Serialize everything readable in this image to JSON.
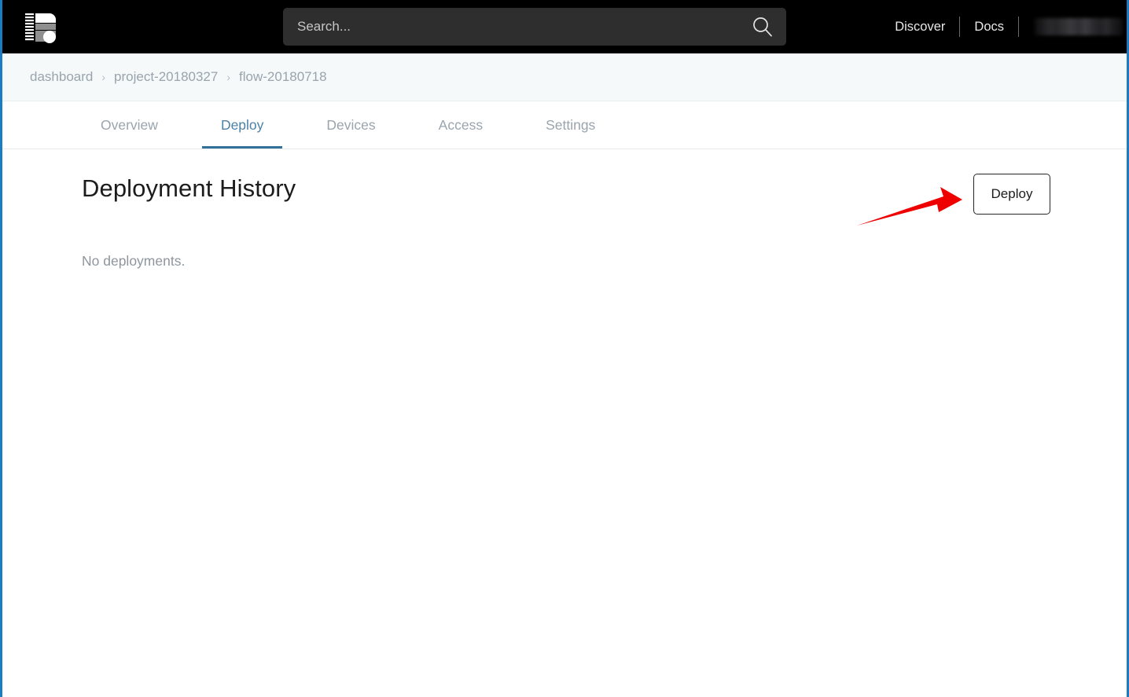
{
  "header": {
    "logo_icon": "balena-e-logo-icon",
    "search": {
      "placeholder": "Search...",
      "value": "",
      "icon": "search-icon"
    },
    "nav": {
      "discover_label": "Discover",
      "docs_label": "Docs",
      "user_label": ""
    }
  },
  "breadcrumb": {
    "items": [
      {
        "label": "dashboard"
      },
      {
        "label": "project-20180327"
      },
      {
        "label": "flow-20180718"
      }
    ],
    "separator": "›"
  },
  "tabs": [
    {
      "label": "Overview",
      "active": false
    },
    {
      "label": "Deploy",
      "active": true
    },
    {
      "label": "Devices",
      "active": false
    },
    {
      "label": "Access",
      "active": false
    },
    {
      "label": "Settings",
      "active": false
    }
  ],
  "main": {
    "title": "Deployment History",
    "empty_message": "No deployments.",
    "deploy_button_label": "Deploy"
  },
  "annotation": {
    "type": "arrow",
    "color": "#ef0000",
    "points_to": "deploy-button"
  },
  "colors": {
    "header_bg": "#000000",
    "search_bg": "#2e2e2e",
    "breadcrumb_bg": "#f5f9fa",
    "tab_active": "#4b82a6",
    "tab_underline": "#2f7199",
    "tab_inactive": "#9aa4ad",
    "muted_text": "#8d969e",
    "title_text": "#1c1c1c",
    "annotation_red": "#ef0000",
    "frame_blue": "#1b7cc4"
  }
}
